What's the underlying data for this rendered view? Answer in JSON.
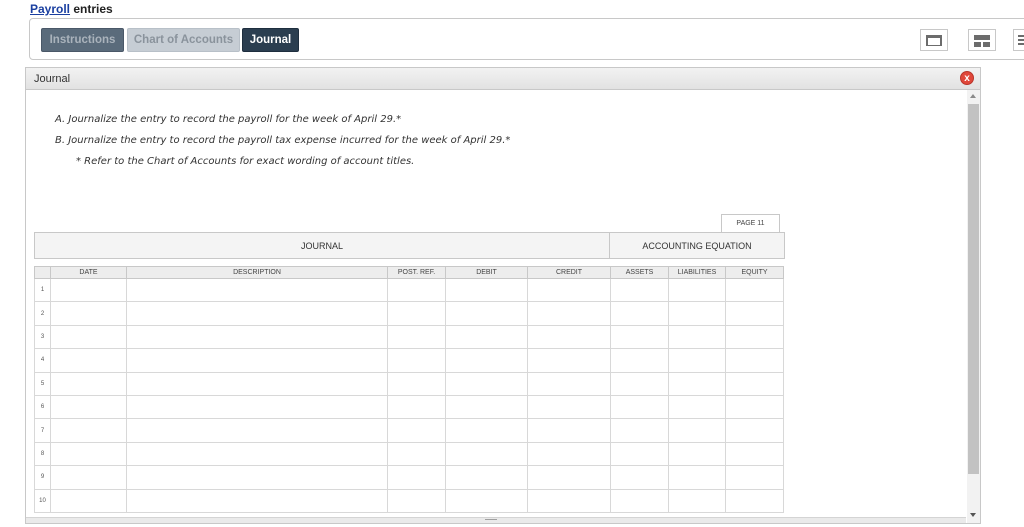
{
  "page": {
    "title_link": "Payroll",
    "title_rest": " entries"
  },
  "tabs": [
    {
      "label": "Instructions"
    },
    {
      "label": "Chart of Accounts"
    },
    {
      "label": "Journal"
    }
  ],
  "layout_icons": [
    "layout-single-icon",
    "layout-split-icon",
    "layout-list-icon"
  ],
  "panel": {
    "title": "Journal",
    "close_label": "x"
  },
  "instructions": {
    "a": "A.  Journalize the entry to record the payroll for the week of April 29.*",
    "b": "B.  Journalize the entry to record the payroll tax expense incurred for the week of April 29.*",
    "note": "* Refer to the Chart of Accounts for exact wording of account titles."
  },
  "journal": {
    "page_label": "PAGE 11",
    "journal_heading": "JOURNAL",
    "equation_heading": "ACCOUNTING EQUATION",
    "columns": [
      "",
      "DATE",
      "DESCRIPTION",
      "POST. REF.",
      "DEBIT",
      "CREDIT",
      "ASSETS",
      "LIABILITIES",
      "EQUITY"
    ],
    "rows": [
      "1",
      "2",
      "3",
      "4",
      "5",
      "6",
      "7",
      "8",
      "9",
      "10"
    ]
  },
  "colors": {
    "active_tab": "#2b3e50",
    "link": "#1a3fa0",
    "close": "#e0473a"
  }
}
